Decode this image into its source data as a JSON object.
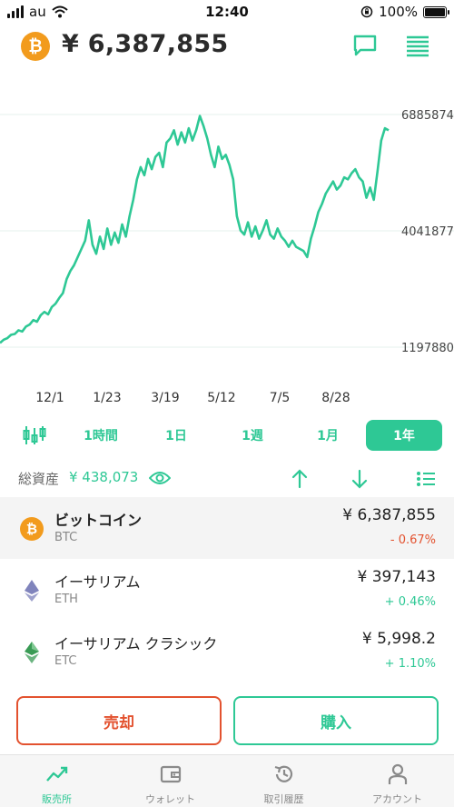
{
  "status_bar": {
    "carrier": "au",
    "time": "12:40",
    "battery": "100%"
  },
  "header": {
    "coin_symbol": "₿",
    "price": "¥ 6,387,855"
  },
  "chart_data": {
    "type": "line",
    "title": "",
    "x_ticks": [
      "12/1",
      "1/23",
      "3/19",
      "5/12",
      "7/5",
      "8/28"
    ],
    "y_ticks": [
      "6885874",
      "4041877",
      "1197880"
    ],
    "ylim": [
      1197880,
      6885874
    ],
    "series": [
      {
        "color": "#2ec895",
        "values": [
          1300000,
          1380000,
          1420000,
          1500000,
          1520000,
          1610000,
          1580000,
          1700000,
          1750000,
          1860000,
          1820000,
          1980000,
          2060000,
          2000000,
          2180000,
          2260000,
          2400000,
          2520000,
          2860000,
          3060000,
          3200000,
          3400000,
          3600000,
          3800000,
          4300000,
          3700000,
          3480000,
          3900000,
          3600000,
          4100000,
          3700000,
          4000000,
          3750000,
          4200000,
          3900000,
          4400000,
          4800000,
          5300000,
          5600000,
          5400000,
          5800000,
          5550000,
          5850000,
          5950000,
          5600000,
          6200000,
          6300000,
          6500000,
          6150000,
          6450000,
          6200000,
          6550000,
          6250000,
          6500000,
          6850000,
          6600000,
          6300000,
          5900000,
          5600000,
          6100000,
          5800000,
          5900000,
          5650000,
          5300000,
          4400000,
          4050000,
          3950000,
          4250000,
          3900000,
          4150000,
          3850000,
          4050000,
          4300000,
          3950000,
          3850000,
          4100000,
          3900000,
          3800000,
          3650000,
          3800000,
          3650000,
          3600000,
          3550000,
          3400000,
          3850000,
          4150000,
          4500000,
          4700000,
          4950000,
          5100000,
          5250000,
          5050000,
          5150000,
          5350000,
          5300000,
          5450000,
          5550000,
          5350000,
          5250000,
          4850000,
          5100000,
          4800000,
          5500000,
          6250000,
          6550000,
          6500000
        ]
      }
    ]
  },
  "range_tabs": [
    {
      "label": "1時間"
    },
    {
      "label": "1日"
    },
    {
      "label": "1週"
    },
    {
      "label": "1月"
    },
    {
      "label": "1年",
      "active": true
    }
  ],
  "assets": {
    "label": "総資産",
    "value": "¥ 438,073"
  },
  "coins": [
    {
      "name": "ビットコイン",
      "symbol": "BTC",
      "price": "¥ 6,387,855",
      "change": "- 0.67%",
      "direction": "neg",
      "icon": "bitcoin-icon",
      "color": "#f29b1d"
    },
    {
      "name": "イーサリアム",
      "symbol": "ETH",
      "price": "¥ 397,143",
      "change": "+ 0.46%",
      "direction": "pos",
      "icon": "ethereum-icon",
      "color": "#6a6fb0"
    },
    {
      "name": "イーサリアム クラシック",
      "symbol": "ETC",
      "price": "¥ 5,998.2",
      "change": "+ 1.10%",
      "direction": "pos",
      "icon": "ethereum-classic-icon",
      "color": "#3a9b55"
    }
  ],
  "actions": {
    "sell": "売却",
    "buy": "購入"
  },
  "bottom_nav": [
    {
      "label": "販売所",
      "icon": "chart-trend-icon",
      "active": true
    },
    {
      "label": "ウォレット",
      "icon": "wallet-icon"
    },
    {
      "label": "取引履歴",
      "icon": "history-icon"
    },
    {
      "label": "アカウント",
      "icon": "account-icon"
    }
  ],
  "colors": {
    "accent": "#2ec895",
    "negative": "#e3522f",
    "bitcoin": "#f29b1d"
  }
}
